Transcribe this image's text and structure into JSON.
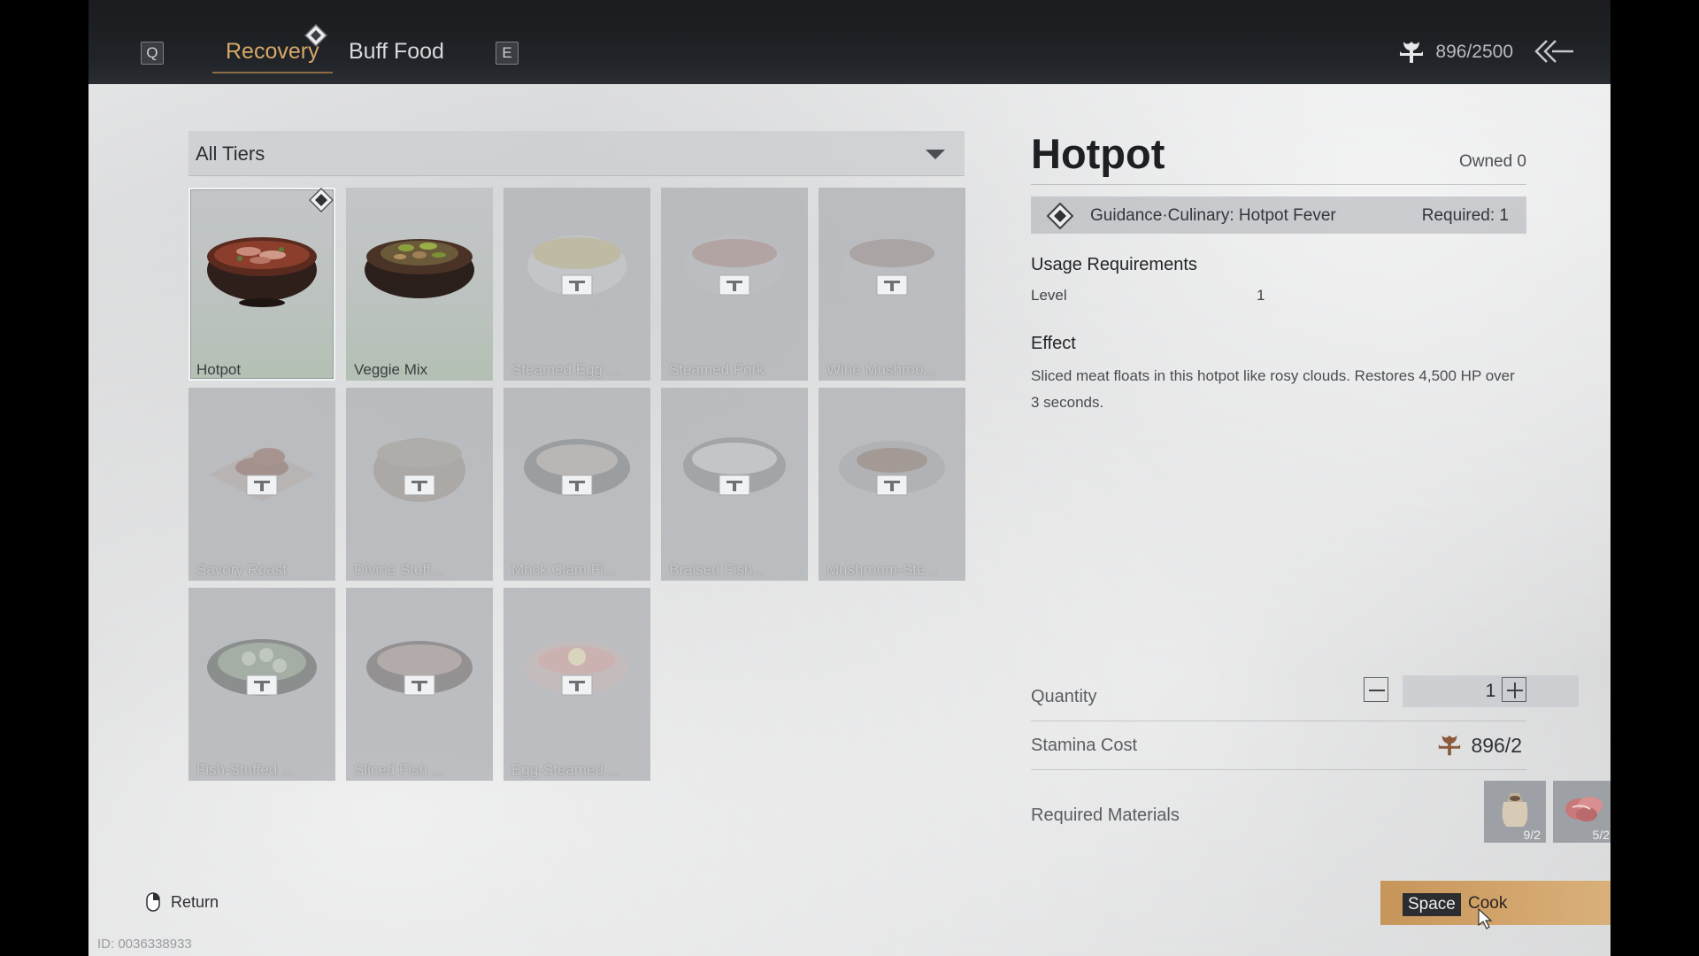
{
  "topbar": {
    "key_left": "Q",
    "key_right": "E",
    "tabs": [
      {
        "label": "Recovery",
        "active": true
      },
      {
        "label": "Buff Food",
        "active": false
      }
    ],
    "stamina": "896/2500"
  },
  "filter": {
    "selected": "All Tiers"
  },
  "recipes": [
    {
      "name": "Hotpot",
      "state": "selected"
    },
    {
      "name": "Veggie Mix",
      "state": "unlocked"
    },
    {
      "name": "Steamed Egg ...",
      "state": "locked"
    },
    {
      "name": "Steamed Pork",
      "state": "locked"
    },
    {
      "name": "Wine Mushroo...",
      "state": "locked"
    },
    {
      "name": "Savory Roast",
      "state": "locked"
    },
    {
      "name": "Divine Stuff...",
      "state": "locked"
    },
    {
      "name": "Mock Clam Fi...",
      "state": "locked"
    },
    {
      "name": "Braised Fish...",
      "state": "locked"
    },
    {
      "name": "Mushroom-Ste...",
      "state": "locked"
    },
    {
      "name": "Fish-Stuffed ...",
      "state": "locked"
    },
    {
      "name": "Sliced Fish ...",
      "state": "locked"
    },
    {
      "name": "Egg-Steamed ...",
      "state": "locked"
    }
  ],
  "detail": {
    "title": "Hotpot",
    "owned": "Owned 0",
    "guidance": {
      "name": "Guidance·Culinary: Hotpot Fever",
      "required": "Required: 1"
    },
    "usage_heading": "Usage Requirements",
    "level_label": "Level",
    "level_value": "1",
    "effect_heading": "Effect",
    "effect_text": "Sliced meat floats in this hotpot like rosy clouds. Restores 4,500 HP over 3 seconds.",
    "quantity_label": "Quantity",
    "quantity_value": "1",
    "stamina_label": "Stamina Cost",
    "stamina_value": "896/2",
    "materials_label": "Required Materials",
    "materials": [
      {
        "icon": "grain-sack-icon",
        "count": "9/2"
      },
      {
        "icon": "raw-meat-icon",
        "count": "5/2"
      }
    ]
  },
  "bottom": {
    "return_label": "Return",
    "cook_key": "Space",
    "cook_label": "Cook",
    "record_id": "ID: 0036338933"
  },
  "colors": {
    "accent_gold": "#d6a86a",
    "cook_button": "#d3a66d",
    "topbar": "#1f2226"
  }
}
